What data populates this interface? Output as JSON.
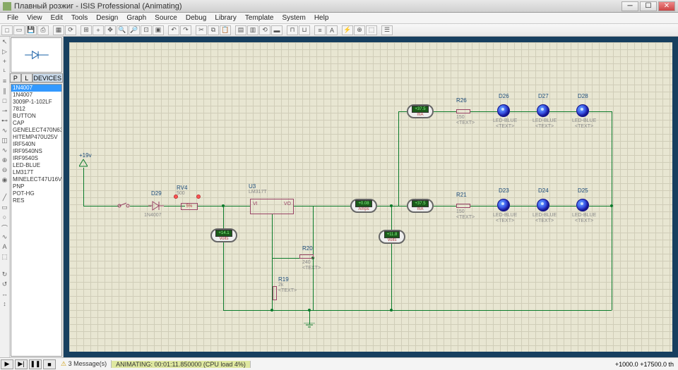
{
  "window": {
    "title": "Плавный розжиг - ISIS Professional (Animating)"
  },
  "menu": [
    "File",
    "View",
    "Edit",
    "Tools",
    "Design",
    "Graph",
    "Source",
    "Debug",
    "Library",
    "Template",
    "System",
    "Help"
  ],
  "sidepanel": {
    "pl_tabs": {
      "p": "P",
      "l": "L",
      "devices": "DEVICES"
    },
    "devices": [
      "1N4007",
      "1N4007",
      "3009P-1-102LF",
      "7812",
      "BUTTON",
      "CAP",
      "GENELECT470N63V",
      "HITEMP470U25V",
      "IRF540N",
      "IRF9540NS",
      "IRF9540S",
      "LED-BLUE",
      "LM317T",
      "MINELECT47U16V",
      "PNP",
      "POT-HG",
      "RES"
    ]
  },
  "schematic": {
    "supply": "+19v",
    "diode": {
      "ref": "D29",
      "val": "1N4007"
    },
    "pot": {
      "ref": "RV4",
      "val": "500",
      "pct": "5%"
    },
    "reg": {
      "ref": "U3",
      "val": "LM317T",
      "pin_vi": "VI",
      "pin_vo": "VO"
    },
    "r20": {
      "ref": "R20",
      "val": "240"
    },
    "r19": {
      "ref": "R19",
      "val": "2k"
    },
    "r26": {
      "ref": "R26",
      "val": "150"
    },
    "r21": {
      "ref": "R21",
      "val": "150"
    },
    "leds_top": [
      {
        "ref": "D26"
      },
      {
        "ref": "D27"
      },
      {
        "ref": "D28"
      }
    ],
    "leds_bot": [
      {
        "ref": "D23"
      },
      {
        "ref": "D24"
      },
      {
        "ref": "D25"
      }
    ],
    "led_type": "LED-BLUE",
    "text_ph": "<TEXT>",
    "meters": {
      "m_top_ma": {
        "val": "+37.5",
        "unit": "mA"
      },
      "m_mid_amps": {
        "val": "+0.08",
        "unit": "Amps"
      },
      "m_mid_ma": {
        "val": "+37.5",
        "unit": "mA"
      },
      "m_left_v": {
        "val": "+14.1",
        "unit": "Volts"
      },
      "m_right_v": {
        "val": "+11.8",
        "unit": "Volts"
      }
    }
  },
  "status": {
    "messages": "3 Message(s)",
    "anim": "ANIMATING: 00:01:11.850000 (CPU load 4%)",
    "coords": "+1000.0  +17500.0   th"
  }
}
